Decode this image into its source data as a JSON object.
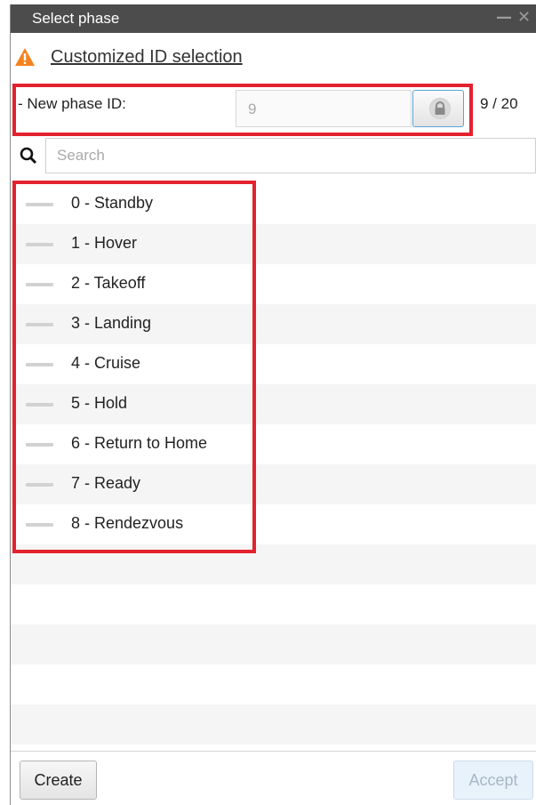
{
  "window": {
    "title": "Select phase",
    "controls": [
      "—",
      "✕"
    ]
  },
  "warning": {
    "icon": "warning-triangle-icon",
    "text": "Customized ID selection"
  },
  "new_id": {
    "label": "- New phase ID:",
    "value": "9",
    "lock_icon": "lock-icon",
    "count": "9 / 20"
  },
  "search": {
    "placeholder": "Search",
    "value": ""
  },
  "phases": [
    {
      "label": "0 - Standby"
    },
    {
      "label": "1 - Hover"
    },
    {
      "label": "2 - Takeoff"
    },
    {
      "label": "3 - Landing"
    },
    {
      "label": "4 - Cruise"
    },
    {
      "label": "5 - Hold"
    },
    {
      "label": "6 - Return to Home"
    },
    {
      "label": "7 - Ready"
    },
    {
      "label": "8 - Rendezvous"
    }
  ],
  "buttons": {
    "create": "Create",
    "accept": "Accept"
  },
  "colors": {
    "highlight": "#e3222e",
    "warning": "#f5821f",
    "titlebar": "#4c4c4c"
  }
}
